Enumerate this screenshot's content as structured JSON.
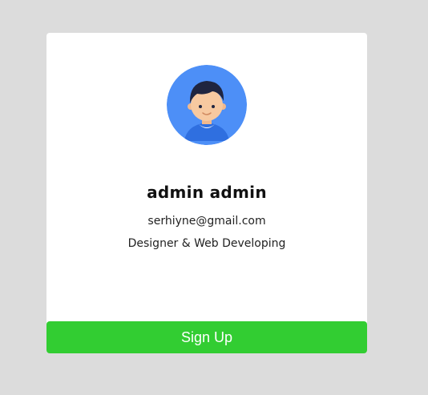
{
  "profile": {
    "name": "admin admin",
    "email": "serhiyne@gmail.com",
    "role": "Designer & Web Developing",
    "avatar_icon": "user-avatar-icon"
  },
  "actions": {
    "signup_label": "Sign Up"
  },
  "colors": {
    "page_background": "#dcdcdc",
    "card_background": "#ffffff",
    "signup_button": "#32cd32",
    "avatar_background": "#4d8ff7"
  }
}
